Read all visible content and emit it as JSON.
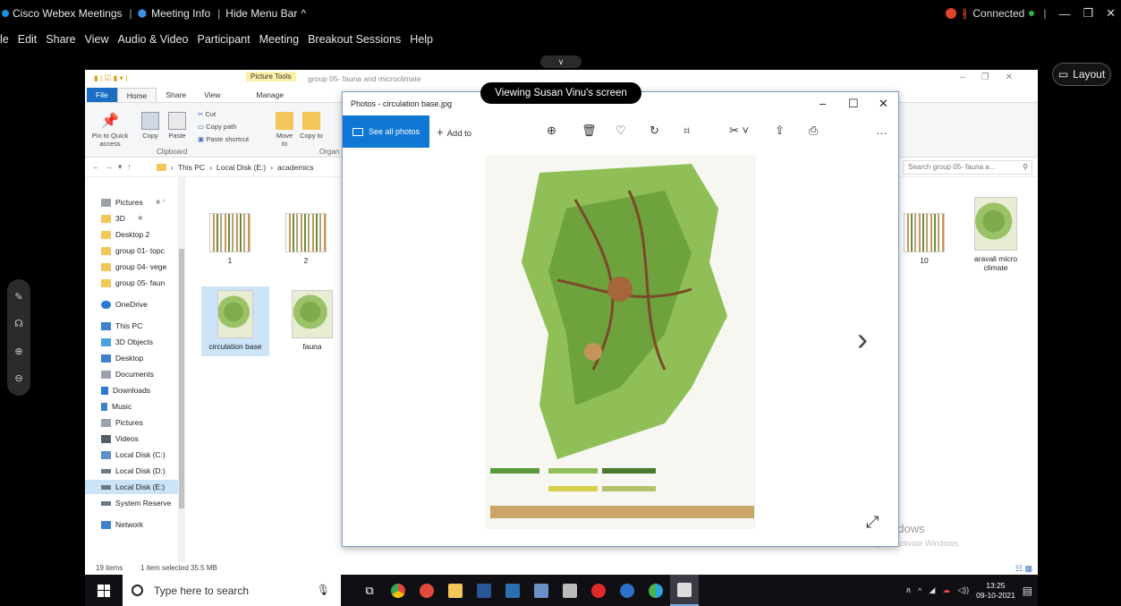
{
  "webex": {
    "title": "Cisco Webex Meetings",
    "meeting_info": "Meeting Info",
    "hide_menu": "Hide Menu Bar",
    "status": "Connected",
    "menu": [
      "le",
      "Edit",
      "Share",
      "View",
      "Audio & Video",
      "Participant",
      "Meeting",
      "Breakout Sessions",
      "Help"
    ],
    "layout_label": "Layout",
    "viewing_label": "Viewing Susan Vinu's screen"
  },
  "explorer": {
    "picture_tools": "Picture Tools",
    "window_title": "group 05- fauna and microclimate",
    "tabs": [
      "File",
      "Home",
      "Share",
      "View",
      "Manage"
    ],
    "ribbon": {
      "pin_to_quick": "Pin to Quick access",
      "copy": "Copy",
      "paste": "Paste",
      "cut": "Cut",
      "copy_path": "Copy path",
      "paste_shortcut": "Paste shortcut",
      "move_to": "Move to",
      "copy_to": "Copy to",
      "clipboard_group": "Clipboard",
      "organize_group": "Organ"
    },
    "address": [
      "This PC",
      "Local Disk (E:)",
      "academics"
    ],
    "search_placeholder": "Search group 05- fauna a...",
    "nav": [
      "Pictures",
      "3D",
      "Desktop 2",
      "group 01- topc",
      "group 04- vege",
      "group 05- faun",
      "OneDrive",
      "This PC",
      "3D Objects",
      "Desktop",
      "Documents",
      "Downloads",
      "Music",
      "Pictures",
      "Videos",
      "Local Disk (C:)",
      "Local Disk (D:)",
      "Local Disk (E:)",
      "System Reserve",
      "Network"
    ],
    "files": [
      "1",
      "2",
      "circulation base",
      "fauna",
      "10",
      "aravali micro climate"
    ],
    "status_count": "19 items",
    "status_selected": "1 item selected  35.5 MB"
  },
  "photos": {
    "title": "Photos - circulation  base.jpg",
    "see_all": "See all photos",
    "add_to": "Add to"
  },
  "windows": {
    "activate_title": "Activate Windows",
    "activate_sub": "Go to Settings to activate Windows.",
    "search_placeholder": "Type here to search",
    "time": "13:25",
    "date": "09-10-2021"
  }
}
